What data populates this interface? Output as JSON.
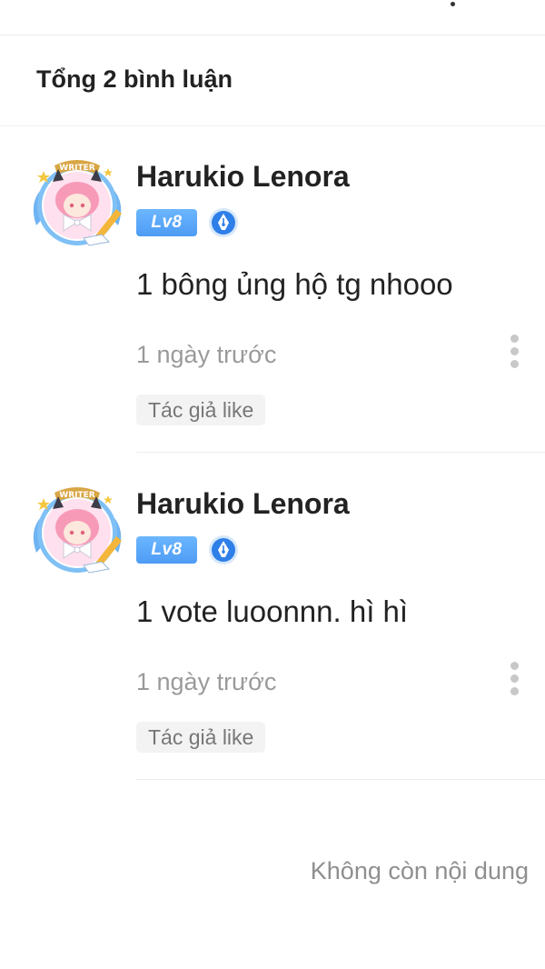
{
  "header": {
    "total_label": "Tổng 2 bình luận"
  },
  "comments": [
    {
      "username": "Harukio Lenora",
      "level": "Lv8",
      "avatar_badge_text": "WRITER",
      "text": "1 bông ủng hộ tg nhooo",
      "time": "1 ngày trước",
      "author_like": "Tác giả like"
    },
    {
      "username": "Harukio Lenora",
      "level": "Lv8",
      "avatar_badge_text": "WRITER",
      "text": "1 vote luoonnn. hì hì",
      "time": "1 ngày trước",
      "author_like": "Tác giả like"
    }
  ],
  "footer": {
    "end_label": "Không còn nội dung"
  },
  "colors": {
    "level_badge": "#5aa8fa",
    "pen_badge": "#2f7fe8",
    "muted_text": "#9a9a9a"
  },
  "icons": {
    "more": "more-vertical-icon",
    "pen_badge": "pen-nib-icon",
    "avatar": "writer-avatar"
  }
}
